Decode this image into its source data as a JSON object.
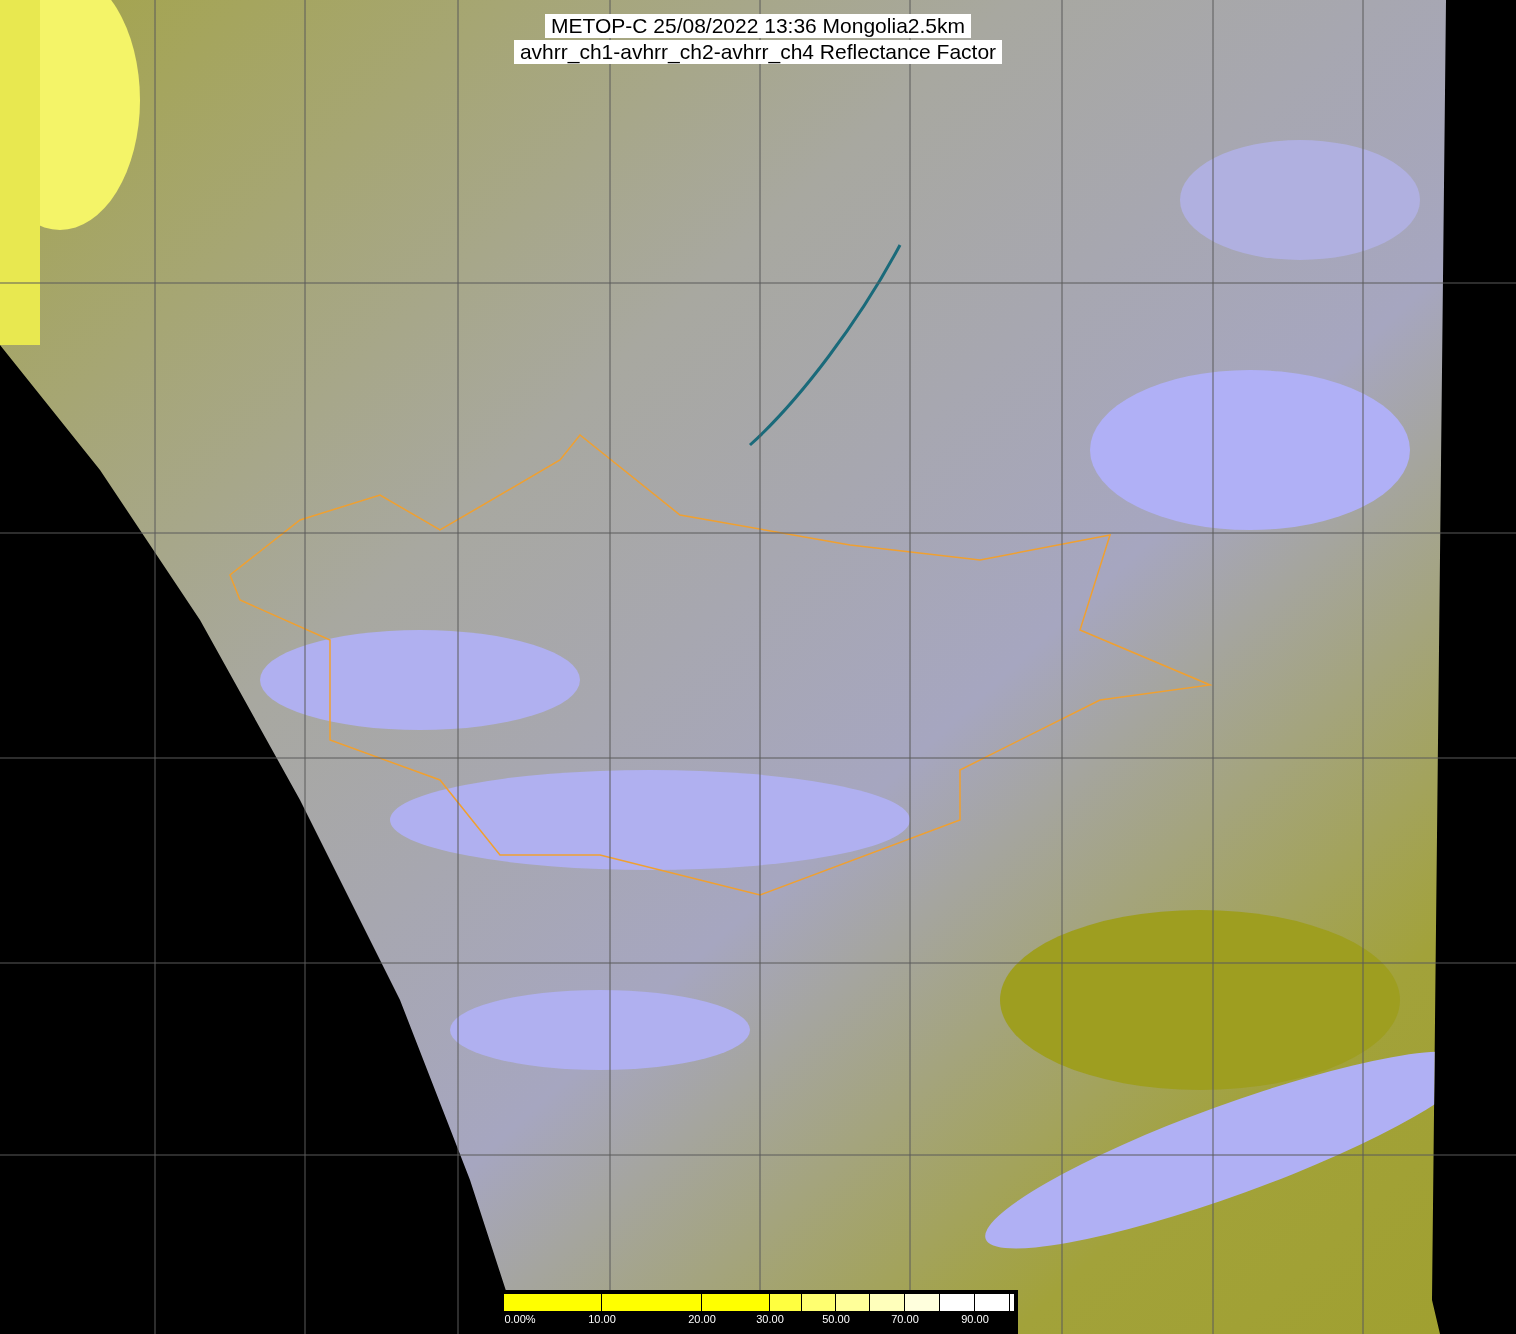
{
  "title": {
    "lines": [
      "METOP-C 25/08/2022 13:36 Mongolia2.5km",
      "avhrr_ch1-avhrr_ch2-avhrr_ch4 Reflectance Factor"
    ]
  },
  "colorbar": {
    "labels": [
      "0.00%",
      "10.00",
      "20.00",
      "30.00",
      "50.00",
      "70.00",
      "90.00"
    ]
  }
}
